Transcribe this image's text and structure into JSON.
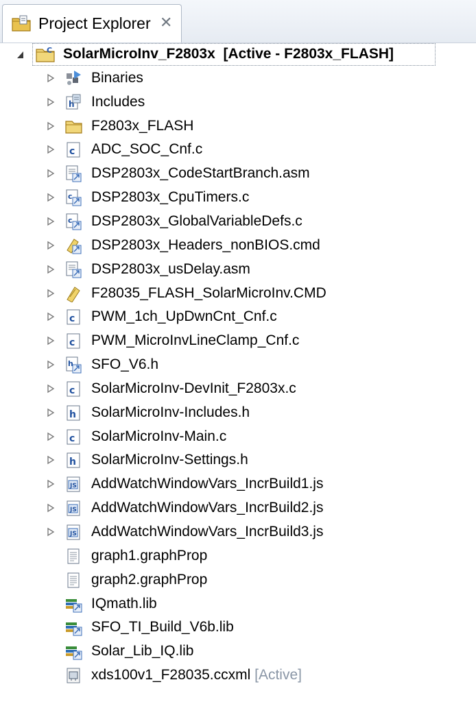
{
  "tab": {
    "title": "Project Explorer",
    "close": "✕"
  },
  "root": {
    "name": "SolarMicroInv_F2803x",
    "status": "[Active - F2803x_FLASH]",
    "icon": "c-project-folder-icon"
  },
  "items": [
    {
      "label": "Binaries",
      "icon": "binaries-icon",
      "expandable": true
    },
    {
      "label": "Includes",
      "icon": "includes-icon",
      "expandable": true
    },
    {
      "label": "F2803x_FLASH",
      "icon": "folder-icon",
      "expandable": true
    },
    {
      "label": "ADC_SOC_Cnf.c",
      "icon": "c-file-icon",
      "expandable": true
    },
    {
      "label": "DSP2803x_CodeStartBranch.asm",
      "icon": "linked-asm-file-icon",
      "expandable": true
    },
    {
      "label": "DSP2803x_CpuTimers.c",
      "icon": "linked-c-file-icon",
      "expandable": true
    },
    {
      "label": "DSP2803x_GlobalVariableDefs.c",
      "icon": "linked-c-file-icon",
      "expandable": true
    },
    {
      "label": "DSP2803x_Headers_nonBIOS.cmd",
      "icon": "linked-cmd-file-icon",
      "expandable": true
    },
    {
      "label": "DSP2803x_usDelay.asm",
      "icon": "linked-asm-file-icon",
      "expandable": true
    },
    {
      "label": "F28035_FLASH_SolarMicroInv.CMD",
      "icon": "cmd-file-icon",
      "expandable": true
    },
    {
      "label": "PWM_1ch_UpDwnCnt_Cnf.c",
      "icon": "c-file-icon",
      "expandable": true
    },
    {
      "label": "PWM_MicroInvLineClamp_Cnf.c",
      "icon": "c-file-icon",
      "expandable": true
    },
    {
      "label": "SFO_V6.h",
      "icon": "linked-h-file-icon",
      "expandable": true
    },
    {
      "label": "SolarMicroInv-DevInit_F2803x.c",
      "icon": "c-file-icon",
      "expandable": true
    },
    {
      "label": "SolarMicroInv-Includes.h",
      "icon": "h-file-icon",
      "expandable": true
    },
    {
      "label": "SolarMicroInv-Main.c",
      "icon": "c-file-icon",
      "expandable": true
    },
    {
      "label": "SolarMicroInv-Settings.h",
      "icon": "h-file-icon",
      "expandable": true
    },
    {
      "label": "AddWatchWindowVars_IncrBuild1.js",
      "icon": "js-file-icon",
      "expandable": true
    },
    {
      "label": "AddWatchWindowVars_IncrBuild2.js",
      "icon": "js-file-icon",
      "expandable": true
    },
    {
      "label": "AddWatchWindowVars_IncrBuild3.js",
      "icon": "js-file-icon",
      "expandable": true
    },
    {
      "label": "graph1.graphProp",
      "icon": "text-file-icon",
      "expandable": false
    },
    {
      "label": "graph2.graphProp",
      "icon": "text-file-icon",
      "expandable": false
    },
    {
      "label": "IQmath.lib",
      "icon": "linked-library-icon",
      "expandable": false
    },
    {
      "label": "SFO_TI_Build_V6b.lib",
      "icon": "linked-library-icon",
      "expandable": false
    },
    {
      "label": "Solar_Lib_IQ.lib",
      "icon": "linked-library-icon",
      "expandable": false
    },
    {
      "label": "xds100v1_F28035.ccxml",
      "suffix": "[Active]",
      "icon": "target-config-file-icon",
      "expandable": false
    }
  ]
}
